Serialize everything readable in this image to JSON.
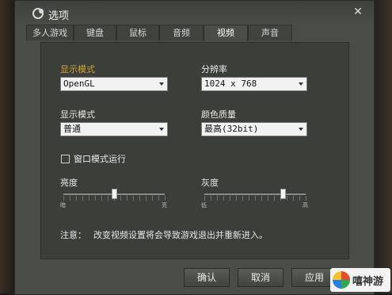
{
  "window": {
    "title": "选项"
  },
  "tabs": [
    {
      "label": "多人游戏",
      "active": false
    },
    {
      "label": "键盘",
      "active": false
    },
    {
      "label": "鼠标",
      "active": false
    },
    {
      "label": "音频",
      "active": false
    },
    {
      "label": "视频",
      "active": true
    },
    {
      "label": "声音",
      "active": false
    }
  ],
  "video": {
    "display_mode_label": "显示模式",
    "display_mode_value": "OpenGL",
    "resolution_label": "分辨率",
    "resolution_value": "1024 x 768",
    "display_mode2_label": "显示模式",
    "display_mode2_value": "普通",
    "color_quality_label": "颜色质量",
    "color_quality_value": "最高(32bit)",
    "windowed_label": "窗口模式运行",
    "windowed_checked": false,
    "brightness_label": "亮度",
    "brightness_min": "暗",
    "brightness_max": "亮",
    "brightness_value": 0.5,
    "gamma_label": "灰度",
    "gamma_min": "低",
    "gamma_max": "高",
    "gamma_value": 0.77,
    "note_prefix": "注意：",
    "note_text": "改变视频设置将会导致游戏退出并重新进入。"
  },
  "buttons": {
    "ok": "确认",
    "cancel": "取消",
    "apply": "应用"
  },
  "watermark": {
    "text": "嘻神游"
  },
  "colors": {
    "accent_label": "#d2a23c",
    "panel_bg": "#3b3e39",
    "window_bg": "#4a4d47"
  }
}
